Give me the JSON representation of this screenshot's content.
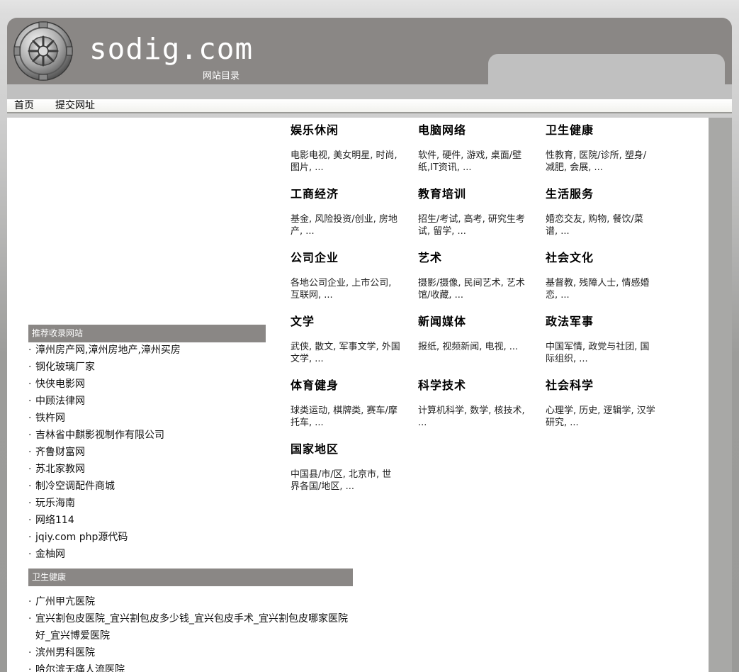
{
  "header": {
    "title": "sodig.com",
    "subtitle": "网站目录",
    "logo_icon": "vault-door-icon"
  },
  "nav": {
    "items": [
      {
        "label": "首页"
      },
      {
        "label": "提交网址"
      }
    ]
  },
  "categories": [
    {
      "title": "娱乐休闲",
      "desc": "电影电视, 美女明星, 时尚, 图片, ..."
    },
    {
      "title": "电脑网络",
      "desc": "软件, 硬件, 游戏, 桌面/壁纸,IT资讯, ..."
    },
    {
      "title": "卫生健康",
      "desc": "性教育, 医院/诊所, 塑身/减肥, 会展, ..."
    },
    {
      "title": "工商经济",
      "desc": "基金, 风险投资/创业, 房地产, ..."
    },
    {
      "title": "教育培训",
      "desc": "招生/考试, 高考, 研究生考试, 留学, ..."
    },
    {
      "title": "生活服务",
      "desc": "婚恋交友, 购物, 餐饮/菜谱, ..."
    },
    {
      "title": "公司企业",
      "desc": "各地公司企业, 上市公司, 互联网, ..."
    },
    {
      "title": "艺术",
      "desc": "摄影/摄像, 民间艺术, 艺术馆/收藏, ..."
    },
    {
      "title": "社会文化",
      "desc": "基督教, 残障人士, 情感婚恋, ..."
    },
    {
      "title": "文学",
      "desc": "武侠, 散文, 军事文学, 外国文学, ..."
    },
    {
      "title": "新闻媒体",
      "desc": "报纸, 视频新闻, 电视, ..."
    },
    {
      "title": "政法军事",
      "desc": "中国军情, 政党与社团, 国际组织, ..."
    },
    {
      "title": "体育健身",
      "desc": "球类运动, 棋牌类, 赛车/摩托车, ..."
    },
    {
      "title": "科学技术",
      "desc": "计算机科学, 数学, 核技术, ..."
    },
    {
      "title": "社会科学",
      "desc": "心理学, 历史, 逻辑学, 汉学研究, ..."
    },
    {
      "title": "国家地区",
      "desc": "中国县/市/区, 北京市, 世界各国/地区, ..."
    }
  ],
  "recommended": {
    "heading": "推荐收录网站",
    "items": [
      "漳州房产网,漳州房地产,漳州买房",
      "钢化玻璃厂家",
      "快侠电影网",
      "中顾法律网",
      "铁杵网",
      "吉林省中麒影视制作有限公司",
      "齐鲁财富网",
      "苏北家教网",
      "制冷空调配件商城",
      "玩乐海南",
      "网络114",
      "jqiy.com php源代码",
      "金柚网"
    ]
  },
  "health": {
    "heading": "卫生健康",
    "items": [
      "广州甲亢医院",
      "宜兴割包皮医院_宜兴割包皮多少钱_宜兴包皮手术_宜兴割包皮哪家医院好_宜兴博爱医院",
      "滨州男科医院",
      "哈尔滨无痛人流医院"
    ]
  }
}
